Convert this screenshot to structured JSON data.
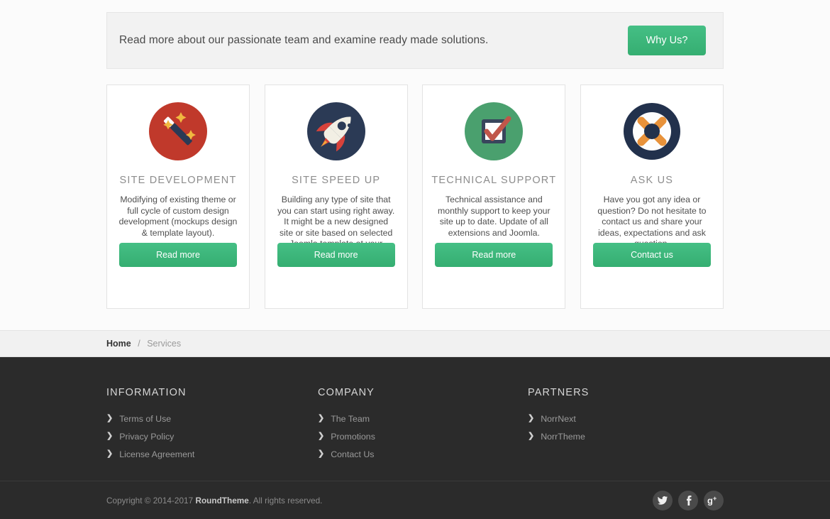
{
  "colors": {
    "accent_green": "#3cb878",
    "page_bg": "#fbfbfb",
    "banner_bg": "#f2f2f2",
    "footer_bg": "#2b2b2b",
    "breadcrumb_bg": "#f1f1f1",
    "icon_red": "#c0392b",
    "icon_navy": "#2b3a55",
    "icon_green": "#4aa06e",
    "icon_orange": "#e8923a"
  },
  "cta": {
    "text": "Read more about our passionate team and examine ready made solutions.",
    "button_label": "Why Us?"
  },
  "cards": [
    {
      "icon_name": "magic-wand-icon",
      "title": "SITE DEVELOPMENT",
      "description": "Modifying of existing theme or full cycle of custom design development (mockups design & template layout).",
      "button_label": "Read more"
    },
    {
      "icon_name": "rocket-icon",
      "title": "SITE SPEED UP",
      "description": "Building any type of site that you can start using right away. It might be a new designed site or site based on selected Joomla template at your choice.",
      "button_label": "Read more"
    },
    {
      "icon_name": "checkbox-check-icon",
      "title": "TECHNICAL SUPPORT",
      "description": "Technical assistance and monthly support to keep your site up to date. Update of all extensions and Joomla.",
      "button_label": "Read more"
    },
    {
      "icon_name": "life-ring-icon",
      "title": "ASK US",
      "description": "Have you got any idea or question? Do not hesitate to contact us and share your ideas, expectations and ask question.",
      "button_label": "Contact us"
    }
  ],
  "breadcrumb": {
    "home_label": "Home",
    "separator": "/",
    "current_label": "Services"
  },
  "footer": {
    "columns": [
      {
        "title": "INFORMATION",
        "links": [
          "Terms of Use",
          "Privacy Policy",
          "License Agreement"
        ]
      },
      {
        "title": "COMPANY",
        "links": [
          "The Team",
          "Promotions",
          "Contact Us"
        ]
      },
      {
        "title": "PARTNERS",
        "links": [
          "NorrNext",
          "NorrTheme"
        ]
      }
    ],
    "copyright_prefix": "Copyright © 2014-2017 ",
    "copyright_brand": "RoundTheme",
    "copyright_suffix": ". All rights reserved.",
    "socials": [
      {
        "name": "twitter-icon",
        "glyph": "twitter"
      },
      {
        "name": "facebook-icon",
        "glyph": "facebook"
      },
      {
        "name": "google-plus-icon",
        "glyph": "gplus"
      }
    ]
  }
}
